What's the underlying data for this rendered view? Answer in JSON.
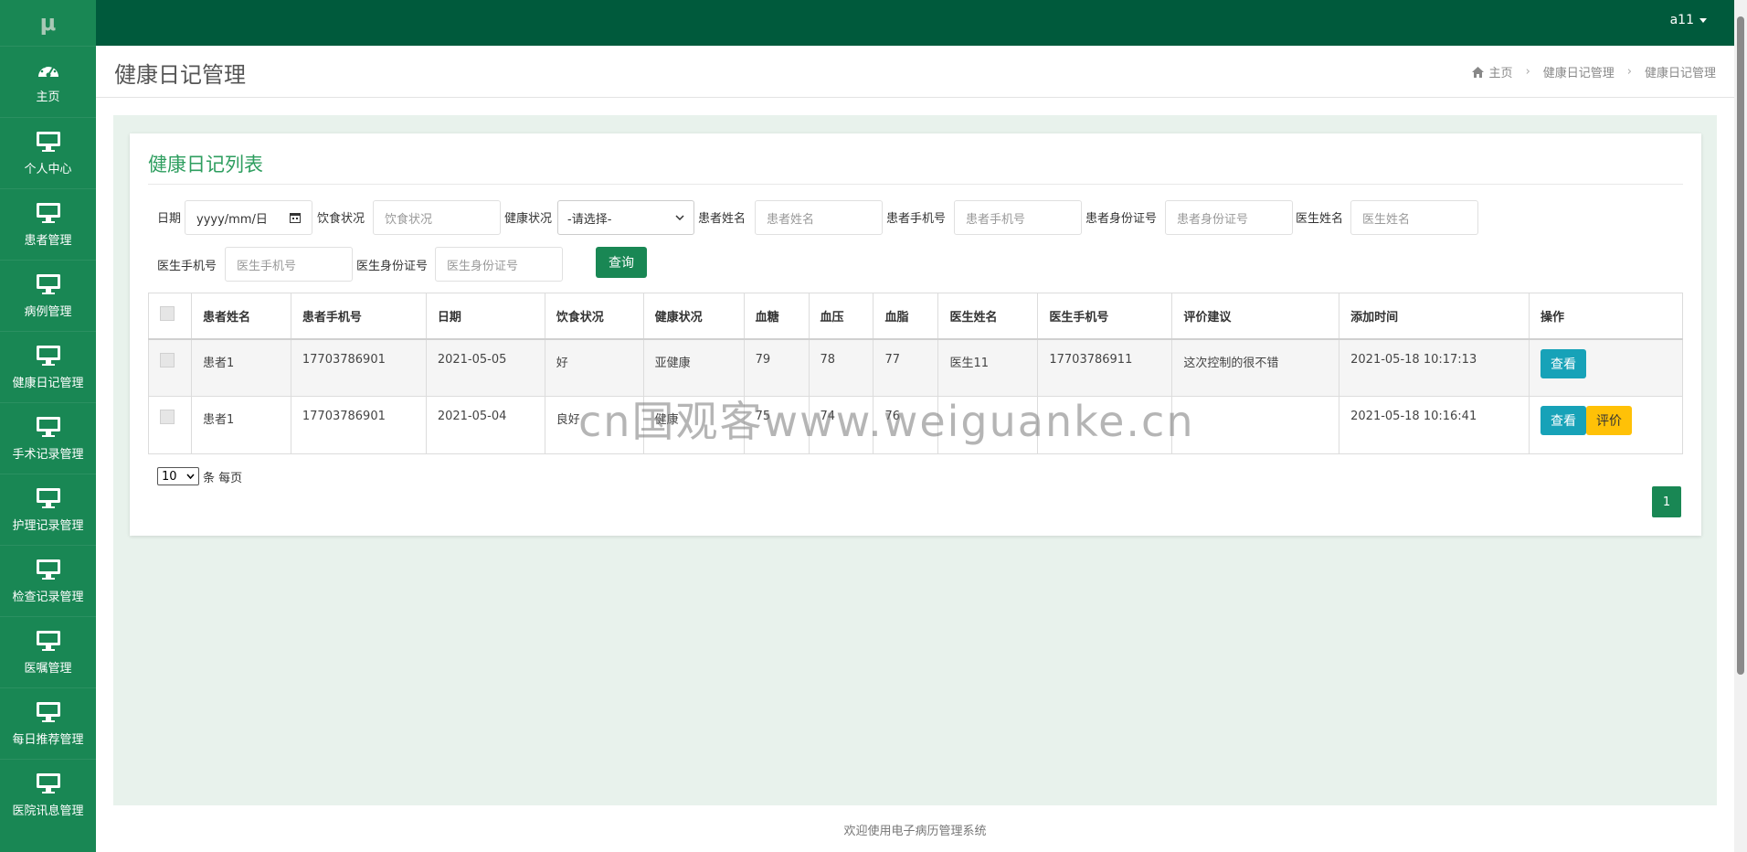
{
  "app": {
    "logo": "μ",
    "user": "a11"
  },
  "sidebar": {
    "items": [
      {
        "label": "主页",
        "icon": "dashboard-icon"
      },
      {
        "label": "个人中心",
        "icon": "monitor-icon"
      },
      {
        "label": "患者管理",
        "icon": "monitor-icon"
      },
      {
        "label": "病例管理",
        "icon": "monitor-icon"
      },
      {
        "label": "健康日记管理",
        "icon": "monitor-icon"
      },
      {
        "label": "手术记录管理",
        "icon": "monitor-icon"
      },
      {
        "label": "护理记录管理",
        "icon": "monitor-icon"
      },
      {
        "label": "检查记录管理",
        "icon": "monitor-icon"
      },
      {
        "label": "医嘱管理",
        "icon": "monitor-icon"
      },
      {
        "label": "每日推荐管理",
        "icon": "monitor-icon"
      },
      {
        "label": "医院讯息管理",
        "icon": "monitor-icon"
      }
    ]
  },
  "header": {
    "title": "健康日记管理",
    "breadcrumb": [
      "主页",
      "健康日记管理",
      "健康日记管理"
    ]
  },
  "panel": {
    "title": "健康日记列表"
  },
  "filters": {
    "date_label": "日期",
    "date_placeholder": "yyyy/mm/日",
    "diet_label": "饮食状况",
    "diet_placeholder": "饮食状况",
    "health_label": "健康状况",
    "health_select": "-请选择-",
    "pname_label": "患者姓名",
    "pname_placeholder": "患者姓名",
    "pphone_label": "患者手机号",
    "pphone_placeholder": "患者手机号",
    "pid_label": "患者身份证号",
    "pid_placeholder": "患者身份证号",
    "dname_label": "医生姓名",
    "dname_placeholder": "医生姓名",
    "dphone_label": "医生手机号",
    "dphone_placeholder": "医生手机号",
    "did_label": "医生身份证号",
    "did_placeholder": "医生身份证号",
    "query_button": "查询"
  },
  "table": {
    "headers": [
      "患者姓名",
      "患者手机号",
      "日期",
      "饮食状况",
      "健康状况",
      "血糖",
      "血压",
      "血脂",
      "医生姓名",
      "医生手机号",
      "评价建议",
      "添加时间",
      "操作"
    ],
    "rows": [
      {
        "patient": "患者1",
        "phone": "17703786901",
        "date": "2021-05-05",
        "diet": "好",
        "health": "亚健康",
        "sugar": "79",
        "pressure": "78",
        "lipid": "77",
        "doctor": "医生11",
        "doctor_phone": "17703786911",
        "comment": "这次控制的很不错",
        "added": "2021-05-18 10:17:13",
        "actions": [
          "查看"
        ]
      },
      {
        "patient": "患者1",
        "phone": "17703786901",
        "date": "2021-05-04",
        "diet": "良好",
        "health": "健康",
        "sugar": "75",
        "pressure": "74",
        "lipid": "76",
        "doctor": "",
        "doctor_phone": "",
        "comment": "",
        "added": "2021-05-18 10:16:41",
        "actions": [
          "查看",
          "评价"
        ]
      }
    ]
  },
  "pagination": {
    "page_size": "10",
    "page_size_suffix": "条 每页",
    "current_page": "1"
  },
  "watermark": "cn国观客www.weiguanke.cn",
  "footer": "欢迎使用电子病历管理系统",
  "colors": {
    "sidebar": "#198754",
    "topbar": "#005a3c",
    "accent": "#2e9e5f",
    "view_button": "#17a2b8",
    "eval_button": "#ffc107"
  }
}
